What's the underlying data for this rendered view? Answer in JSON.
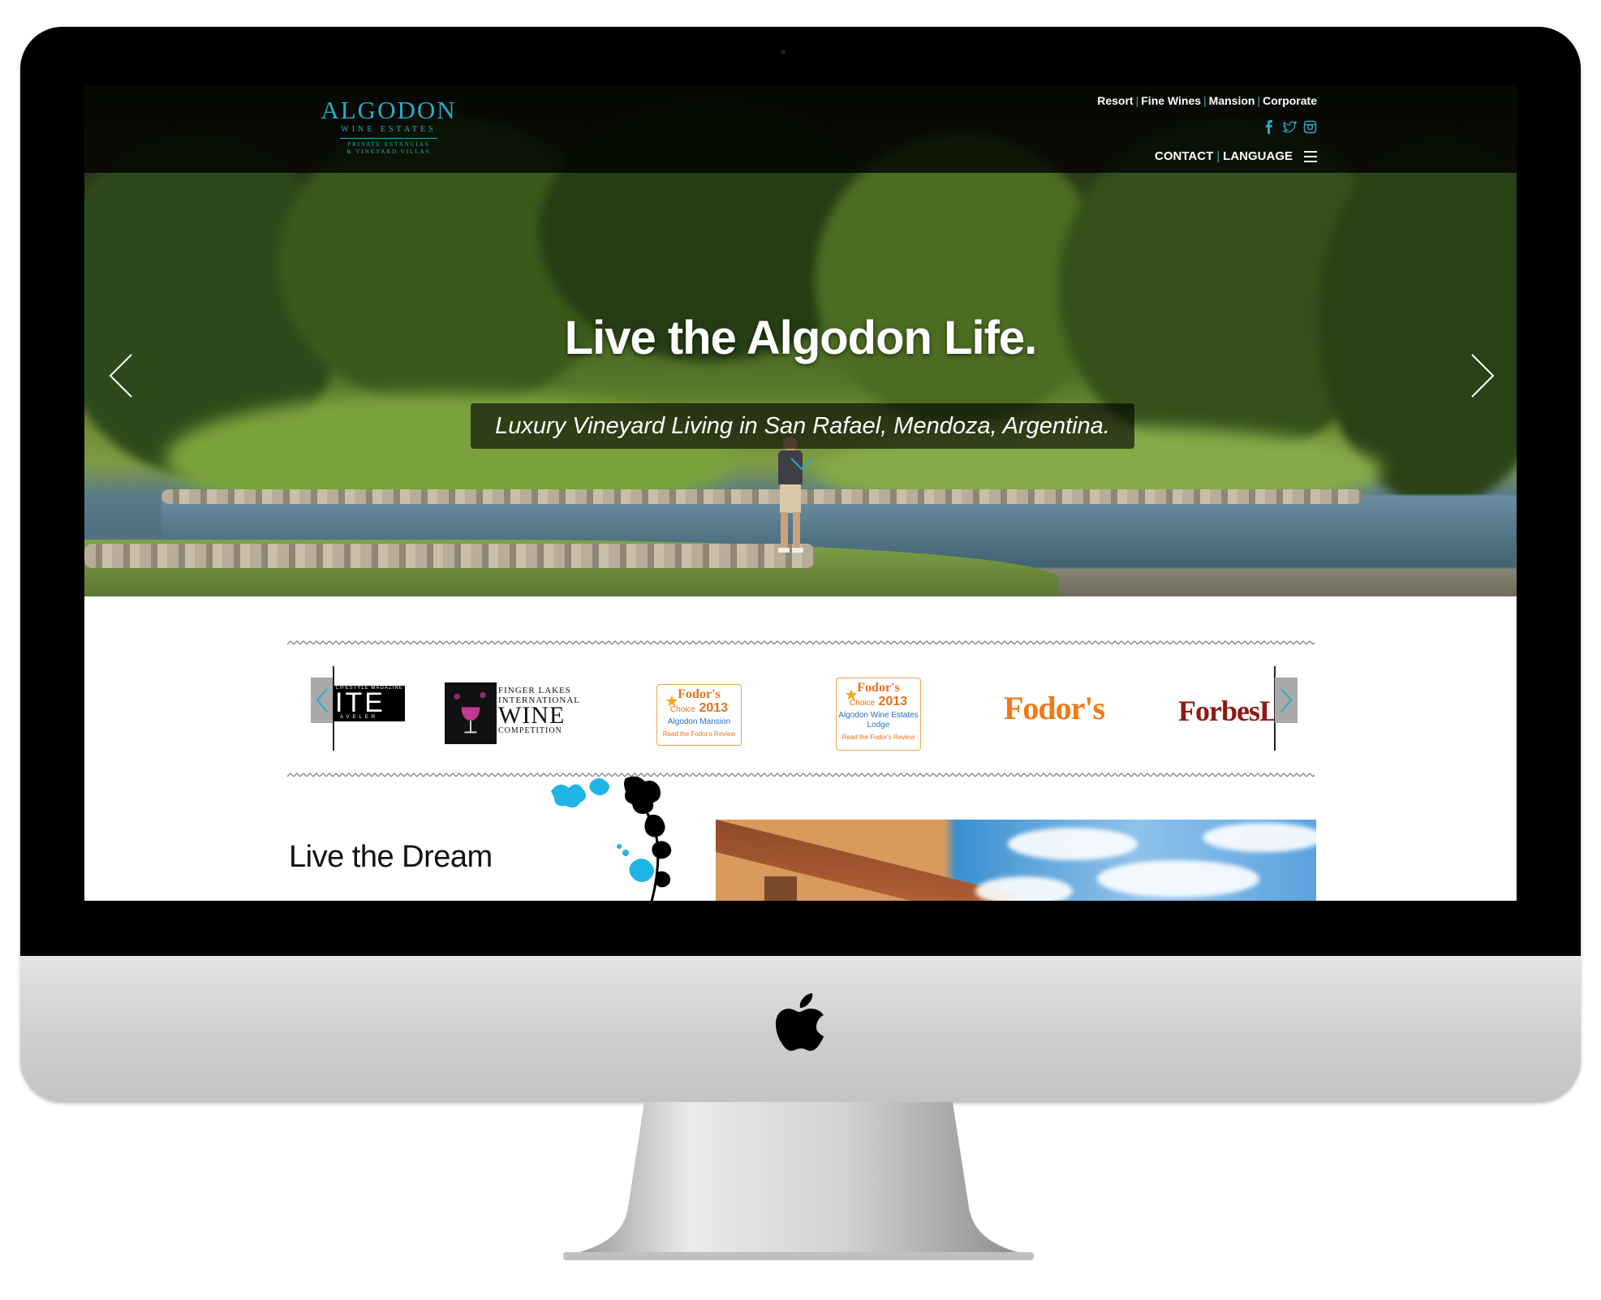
{
  "brand": {
    "name": "ALGODON",
    "subtitle": "WINE ESTATES",
    "tagline_line1": "PRIVATE ESTANCIAS",
    "tagline_line2": "& VINEYARD VILLAS",
    "accent_color": "#2aa8cf"
  },
  "top_nav": {
    "items": [
      "Resort",
      "Fine Wines",
      "Mansion",
      "Corporate"
    ],
    "separator": "|"
  },
  "social_icons": [
    "facebook-icon",
    "twitter-icon",
    "instagram-icon"
  ],
  "secondary_nav": {
    "contact": "CONTACT",
    "language": "LANGUAGE",
    "separator": "|"
  },
  "hero": {
    "title": "Live the Algodon Life.",
    "subtitle": "Luxury Vineyard Living in San Rafael, Mendoza, Argentina."
  },
  "press": {
    "lifestyle": {
      "line1": "LIFESTYLE MAGAZINE",
      "line2": "ITE",
      "line3": "AVELER"
    },
    "finger_lakes": {
      "line1": "FINGER LAKES",
      "line2": "INTERNATIONAL",
      "line3": "WINE",
      "line4": "COMPETITION"
    },
    "fodors_badge_1": {
      "brand": "Fodor's",
      "choice": "Choice",
      "year": "2013",
      "name": "Algodon Mansion",
      "cta": "Read the Fodor's Review"
    },
    "fodors_badge_2": {
      "brand": "Fodor's",
      "choice": "Choice",
      "year": "2013",
      "name_line1": "Algodon Wine Estates",
      "name_line2": "Lodge",
      "cta": "Read the Fodor's Review"
    },
    "fodors": "Fodor's",
    "forbes": "ForbesL"
  },
  "section": {
    "title": "Live the Dream"
  }
}
